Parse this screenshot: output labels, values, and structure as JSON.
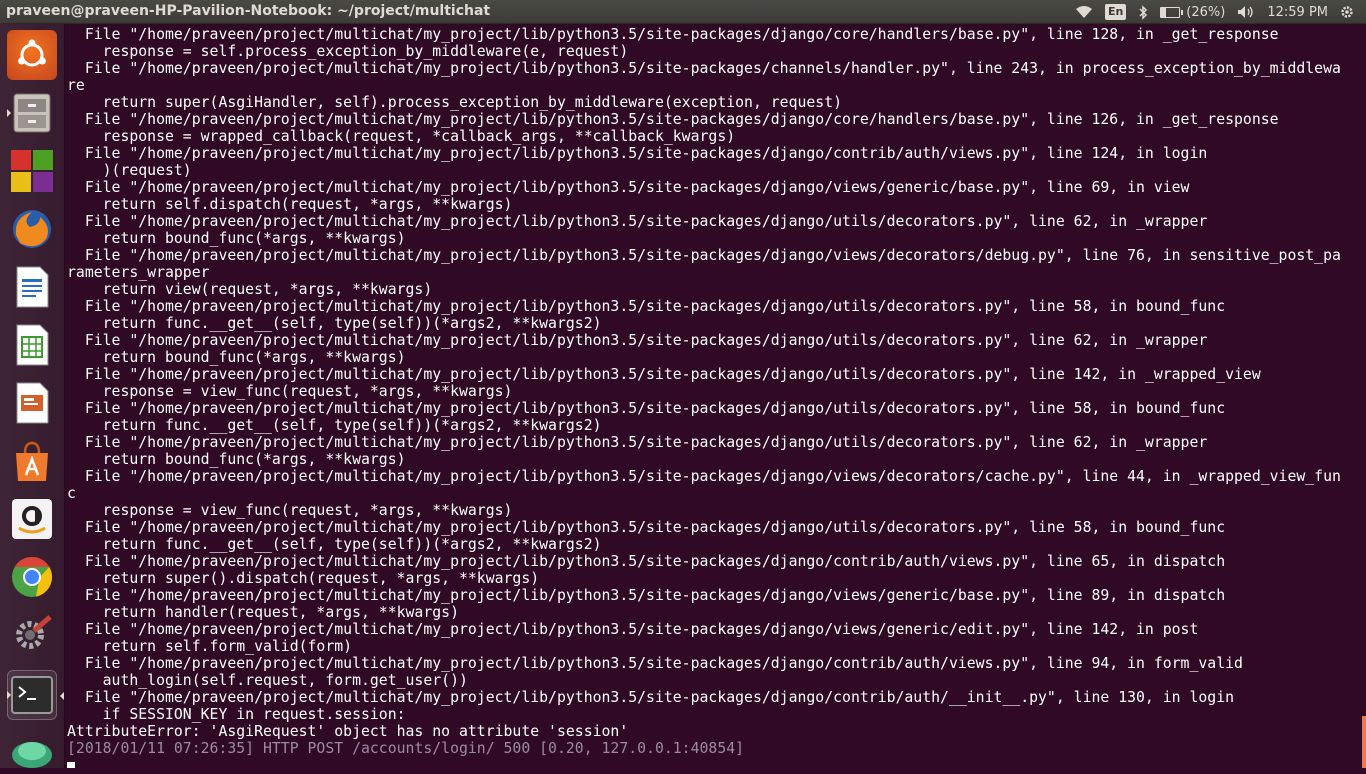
{
  "window": {
    "title": "praveen@praveen-HP-Pavilion-Notebook: ~/project/multichat"
  },
  "indicators": {
    "keyboard_layout": "En",
    "battery_label": "(26%)",
    "battery_level": 0.26,
    "clock": "12:59 PM"
  },
  "launcher": {
    "items": [
      {
        "name": "ubuntu-dash-icon"
      },
      {
        "name": "file-cabinet-icon"
      },
      {
        "name": "workspace-switcher-icon"
      },
      {
        "name": "firefox-icon"
      },
      {
        "name": "libreoffice-writer-icon"
      },
      {
        "name": "libreoffice-calc-icon"
      },
      {
        "name": "libreoffice-impress-icon"
      },
      {
        "name": "software-center-icon"
      },
      {
        "name": "amazon-icon"
      },
      {
        "name": "chrome-icon"
      },
      {
        "name": "system-settings-icon"
      },
      {
        "name": "terminal-icon"
      },
      {
        "name": "app-icon"
      }
    ]
  },
  "colors": {
    "terminal_bg": "#300a24",
    "launcher_bg": "#3e2536",
    "panel_bg": "#3c3b37",
    "scrollbar_accent": "#f07746"
  },
  "terminal": {
    "lines": [
      "  File \"/home/praveen/project/multichat/my_project/lib/python3.5/site-packages/django/core/handlers/base.py\", line 128, in _get_response",
      "    response = self.process_exception_by_middleware(e, request)",
      "  File \"/home/praveen/project/multichat/my_project/lib/python3.5/site-packages/channels/handler.py\", line 243, in process_exception_by_middlewa",
      "re",
      "    return super(AsgiHandler, self).process_exception_by_middleware(exception, request)",
      "  File \"/home/praveen/project/multichat/my_project/lib/python3.5/site-packages/django/core/handlers/base.py\", line 126, in _get_response",
      "    response = wrapped_callback(request, *callback_args, **callback_kwargs)",
      "  File \"/home/praveen/project/multichat/my_project/lib/python3.5/site-packages/django/contrib/auth/views.py\", line 124, in login",
      "    )(request)",
      "  File \"/home/praveen/project/multichat/my_project/lib/python3.5/site-packages/django/views/generic/base.py\", line 69, in view",
      "    return self.dispatch(request, *args, **kwargs)",
      "  File \"/home/praveen/project/multichat/my_project/lib/python3.5/site-packages/django/utils/decorators.py\", line 62, in _wrapper",
      "    return bound_func(*args, **kwargs)",
      "  File \"/home/praveen/project/multichat/my_project/lib/python3.5/site-packages/django/views/decorators/debug.py\", line 76, in sensitive_post_pa",
      "rameters_wrapper",
      "    return view(request, *args, **kwargs)",
      "  File \"/home/praveen/project/multichat/my_project/lib/python3.5/site-packages/django/utils/decorators.py\", line 58, in bound_func",
      "    return func.__get__(self, type(self))(*args2, **kwargs2)",
      "  File \"/home/praveen/project/multichat/my_project/lib/python3.5/site-packages/django/utils/decorators.py\", line 62, in _wrapper",
      "    return bound_func(*args, **kwargs)",
      "  File \"/home/praveen/project/multichat/my_project/lib/python3.5/site-packages/django/utils/decorators.py\", line 142, in _wrapped_view",
      "    response = view_func(request, *args, **kwargs)",
      "  File \"/home/praveen/project/multichat/my_project/lib/python3.5/site-packages/django/utils/decorators.py\", line 58, in bound_func",
      "    return func.__get__(self, type(self))(*args2, **kwargs2)",
      "  File \"/home/praveen/project/multichat/my_project/lib/python3.5/site-packages/django/utils/decorators.py\", line 62, in _wrapper",
      "    return bound_func(*args, **kwargs)",
      "  File \"/home/praveen/project/multichat/my_project/lib/python3.5/site-packages/django/views/decorators/cache.py\", line 44, in _wrapped_view_fun",
      "c",
      "    response = view_func(request, *args, **kwargs)",
      "  File \"/home/praveen/project/multichat/my_project/lib/python3.5/site-packages/django/utils/decorators.py\", line 58, in bound_func",
      "    return func.__get__(self, type(self))(*args2, **kwargs2)",
      "  File \"/home/praveen/project/multichat/my_project/lib/python3.5/site-packages/django/contrib/auth/views.py\", line 65, in dispatch",
      "    return super().dispatch(request, *args, **kwargs)",
      "  File \"/home/praveen/project/multichat/my_project/lib/python3.5/site-packages/django/views/generic/base.py\", line 89, in dispatch",
      "    return handler(request, *args, **kwargs)",
      "  File \"/home/praveen/project/multichat/my_project/lib/python3.5/site-packages/django/views/generic/edit.py\", line 142, in post",
      "    return self.form_valid(form)",
      "  File \"/home/praveen/project/multichat/my_project/lib/python3.5/site-packages/django/contrib/auth/views.py\", line 94, in form_valid",
      "    auth_login(self.request, form.get_user())",
      "  File \"/home/praveen/project/multichat/my_project/lib/python3.5/site-packages/django/contrib/auth/__init__.py\", line 130, in login",
      "    if SESSION_KEY in request.session:",
      "AttributeError: 'AsgiRequest' object has no attribute 'session'"
    ],
    "log_line": "[2018/01/11 07:26:35] HTTP POST /accounts/login/ 500 [0.20, 127.0.0.1:40854]"
  }
}
